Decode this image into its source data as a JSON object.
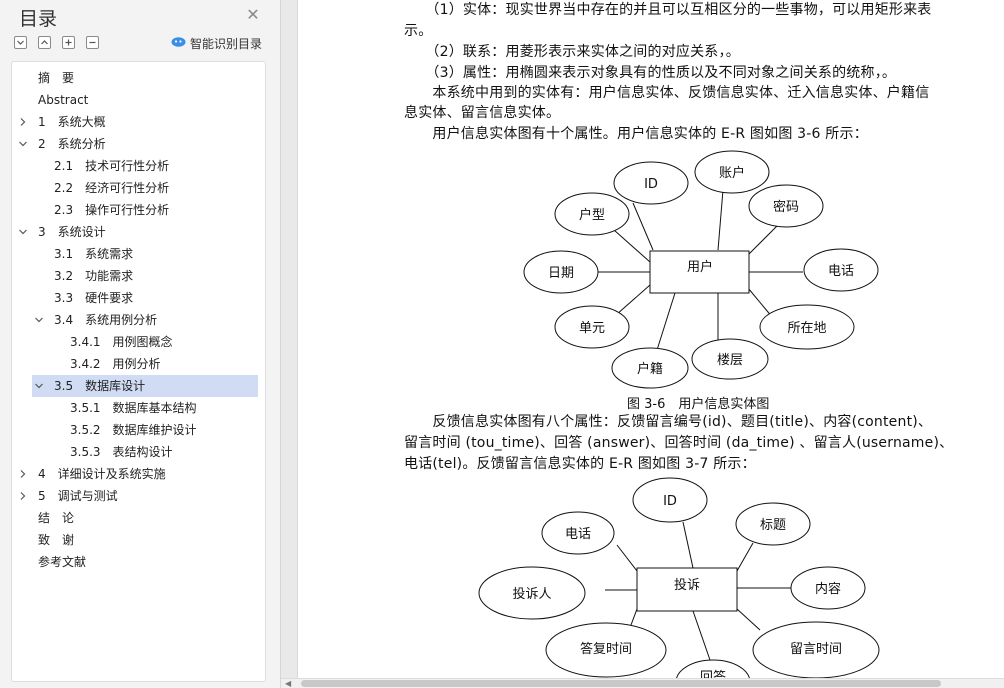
{
  "nav": {
    "title": "目录",
    "smart_label": "智能识别目录",
    "items": [
      {
        "label": "摘　要",
        "level": 0,
        "arrow": ""
      },
      {
        "label": "Abstract",
        "level": 0,
        "arrow": ""
      },
      {
        "label": "1　系统大概",
        "level": 0,
        "arrow": "right"
      },
      {
        "label": "2　系统分析",
        "level": 0,
        "arrow": "down"
      },
      {
        "label": "2.1　技术可行性分析",
        "level": 1,
        "arrow": ""
      },
      {
        "label": "2.2　经济可行性分析",
        "level": 1,
        "arrow": ""
      },
      {
        "label": "2.3　操作可行性分析",
        "level": 1,
        "arrow": ""
      },
      {
        "label": "3　系统设计",
        "level": 0,
        "arrow": "down"
      },
      {
        "label": "3.1　系统需求",
        "level": 1,
        "arrow": ""
      },
      {
        "label": "3.2　功能需求",
        "level": 1,
        "arrow": ""
      },
      {
        "label": "3.3　硬件要求",
        "level": 1,
        "arrow": ""
      },
      {
        "label": "3.4　系统用例分析",
        "level": 1,
        "arrow": "down"
      },
      {
        "label": "3.4.1　用例图概念",
        "level": 2,
        "arrow": ""
      },
      {
        "label": "3.4.2　用例分析",
        "level": 2,
        "arrow": ""
      },
      {
        "label": "3.5　数据库设计",
        "level": 1,
        "arrow": "down",
        "selected": true
      },
      {
        "label": "3.5.1　数据库基本结构",
        "level": 2,
        "arrow": ""
      },
      {
        "label": "3.5.2　数据库维护设计",
        "level": 2,
        "arrow": ""
      },
      {
        "label": "3.5.3　表结构设计",
        "level": 2,
        "arrow": ""
      },
      {
        "label": "4　详细设计及系统实施",
        "level": 0,
        "arrow": "right"
      },
      {
        "label": "5　调试与测试",
        "level": 0,
        "arrow": "right"
      },
      {
        "label": "结　论",
        "level": 0,
        "arrow": ""
      },
      {
        "label": "致　谢",
        "level": 0,
        "arrow": ""
      },
      {
        "label": "参考文献",
        "level": 0,
        "arrow": ""
      }
    ]
  },
  "doc": {
    "lines": [
      "　　（1）实体：现实世界当中存在的并且可以互相区分的一些事物，可以用矩形来表",
      "示。",
      "　　（2）联系：用菱形表示来实体之间的对应关系，。",
      "　　（3）属性：用椭圆来表示对象具有的性质以及不同对象之间关系的统称，。",
      "　　本系统中用到的实体有：用户信息实体、反馈信息实体、迁入信息实体、户籍信",
      "息实体、留言信息实体。",
      "　　用户信息实体图有十个属性。用户信息实体的 E-R 图如图 3-6 所示："
    ],
    "lines2": [
      "　　反馈信息实体图有八个属性：反馈留言编号(id)、题目(title)、内容(content)、",
      "留言时间 (tou_time)、回答 (answer)、回答时间 (da_time) 、留言人(username)、",
      "电话(tel)。反馈留言信息实体的 E-R 图如图 3-7 所示："
    ],
    "caption1": "图 3-6　用户信息实体图",
    "diagram1": {
      "entity": "用户",
      "attributes": [
        "ID",
        "账户",
        "密码",
        "户型",
        "日期",
        "电话",
        "单元",
        "所在地",
        "户籍",
        "楼层"
      ]
    },
    "diagram2": {
      "entity": "投诉",
      "attributes": [
        "ID",
        "电话",
        "标题",
        "投诉人",
        "内容",
        "答复时间",
        "留言时间",
        "回答"
      ]
    }
  }
}
